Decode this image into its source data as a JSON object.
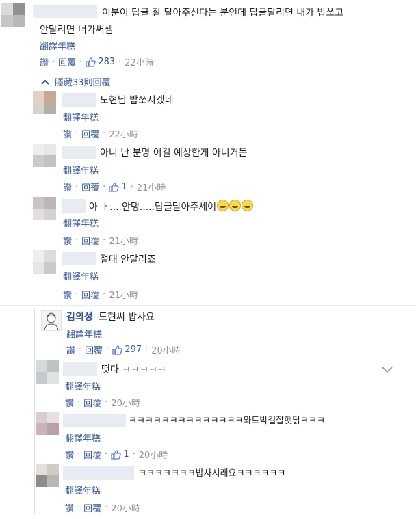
{
  "top_comment": {
    "text_line1": "이분이 답글 잘 달아주신다는 분인데 답글달리면 내가 밥쏘고",
    "text_line2": "안달리면 너가써셈",
    "translate": "翻譯年糕",
    "like": "讚",
    "reply": "回覆",
    "likes": "283",
    "time": "22小時"
  },
  "hidden_replies": "隱藏33則回覆",
  "replies_a": [
    {
      "text": "도현님 밥쏘시겠네",
      "translate": "翻譯年糕",
      "like": "讚",
      "reply": "回覆",
      "likes": "",
      "time": "22小時"
    },
    {
      "text": "아니 난 분명 이걸 예상한게 아니거든",
      "translate": "翻譯年糕",
      "like": "讚",
      "reply": "回覆",
      "likes": "1",
      "time": "21小時"
    },
    {
      "text": "아 ㅏ....안댕.....답글달아주세여",
      "translate": "翻譯年糕",
      "like": "讚",
      "reply": "回覆",
      "likes": "",
      "time": "21小時"
    },
    {
      "text": "절대 안달리죠",
      "translate": "翻譯年糕",
      "like": "讚",
      "reply": "回覆",
      "likes": "",
      "time": "21小時"
    }
  ],
  "comment2": {
    "author": "김의성",
    "text": "도현씨 밥사요",
    "translate": "翻譯年糕",
    "like": "讚",
    "reply": "回覆",
    "likes": "297",
    "time": "20小時"
  },
  "replies_b": [
    {
      "text": "떳다 ㅋㅋㅋㅋㅋ",
      "translate": "翻譯年糕",
      "like": "讚",
      "reply": "回覆",
      "likes": "",
      "time": "20小時"
    },
    {
      "text": "ㅋㅋㅋㅋㅋㅋㅋㅋㅋㅋㅋㅋㅋㅋ와드박길잘햇닭ㅋㅋㅋ",
      "translate": "翻譯年糕",
      "like": "讚",
      "reply": "回覆",
      "likes": "1",
      "time": "20小時"
    },
    {
      "text": "ㅋㅋㅋㅋㅋㅋㅋ밥사시래요ㅋㅋㅋㅋㅋㅋ",
      "translate": "翻譯年糕",
      "like": "讚",
      "reply": "回覆",
      "likes": "",
      "time": "20小時"
    }
  ],
  "icons": {
    "like": "thumbs-up-icon",
    "expand": "chevron-up-icon",
    "options": "chevron-down-icon",
    "laugh": "laughing-emoji-icon"
  },
  "colors": {
    "link": "#365899",
    "meta": "#90949c",
    "text": "#1d2129"
  }
}
